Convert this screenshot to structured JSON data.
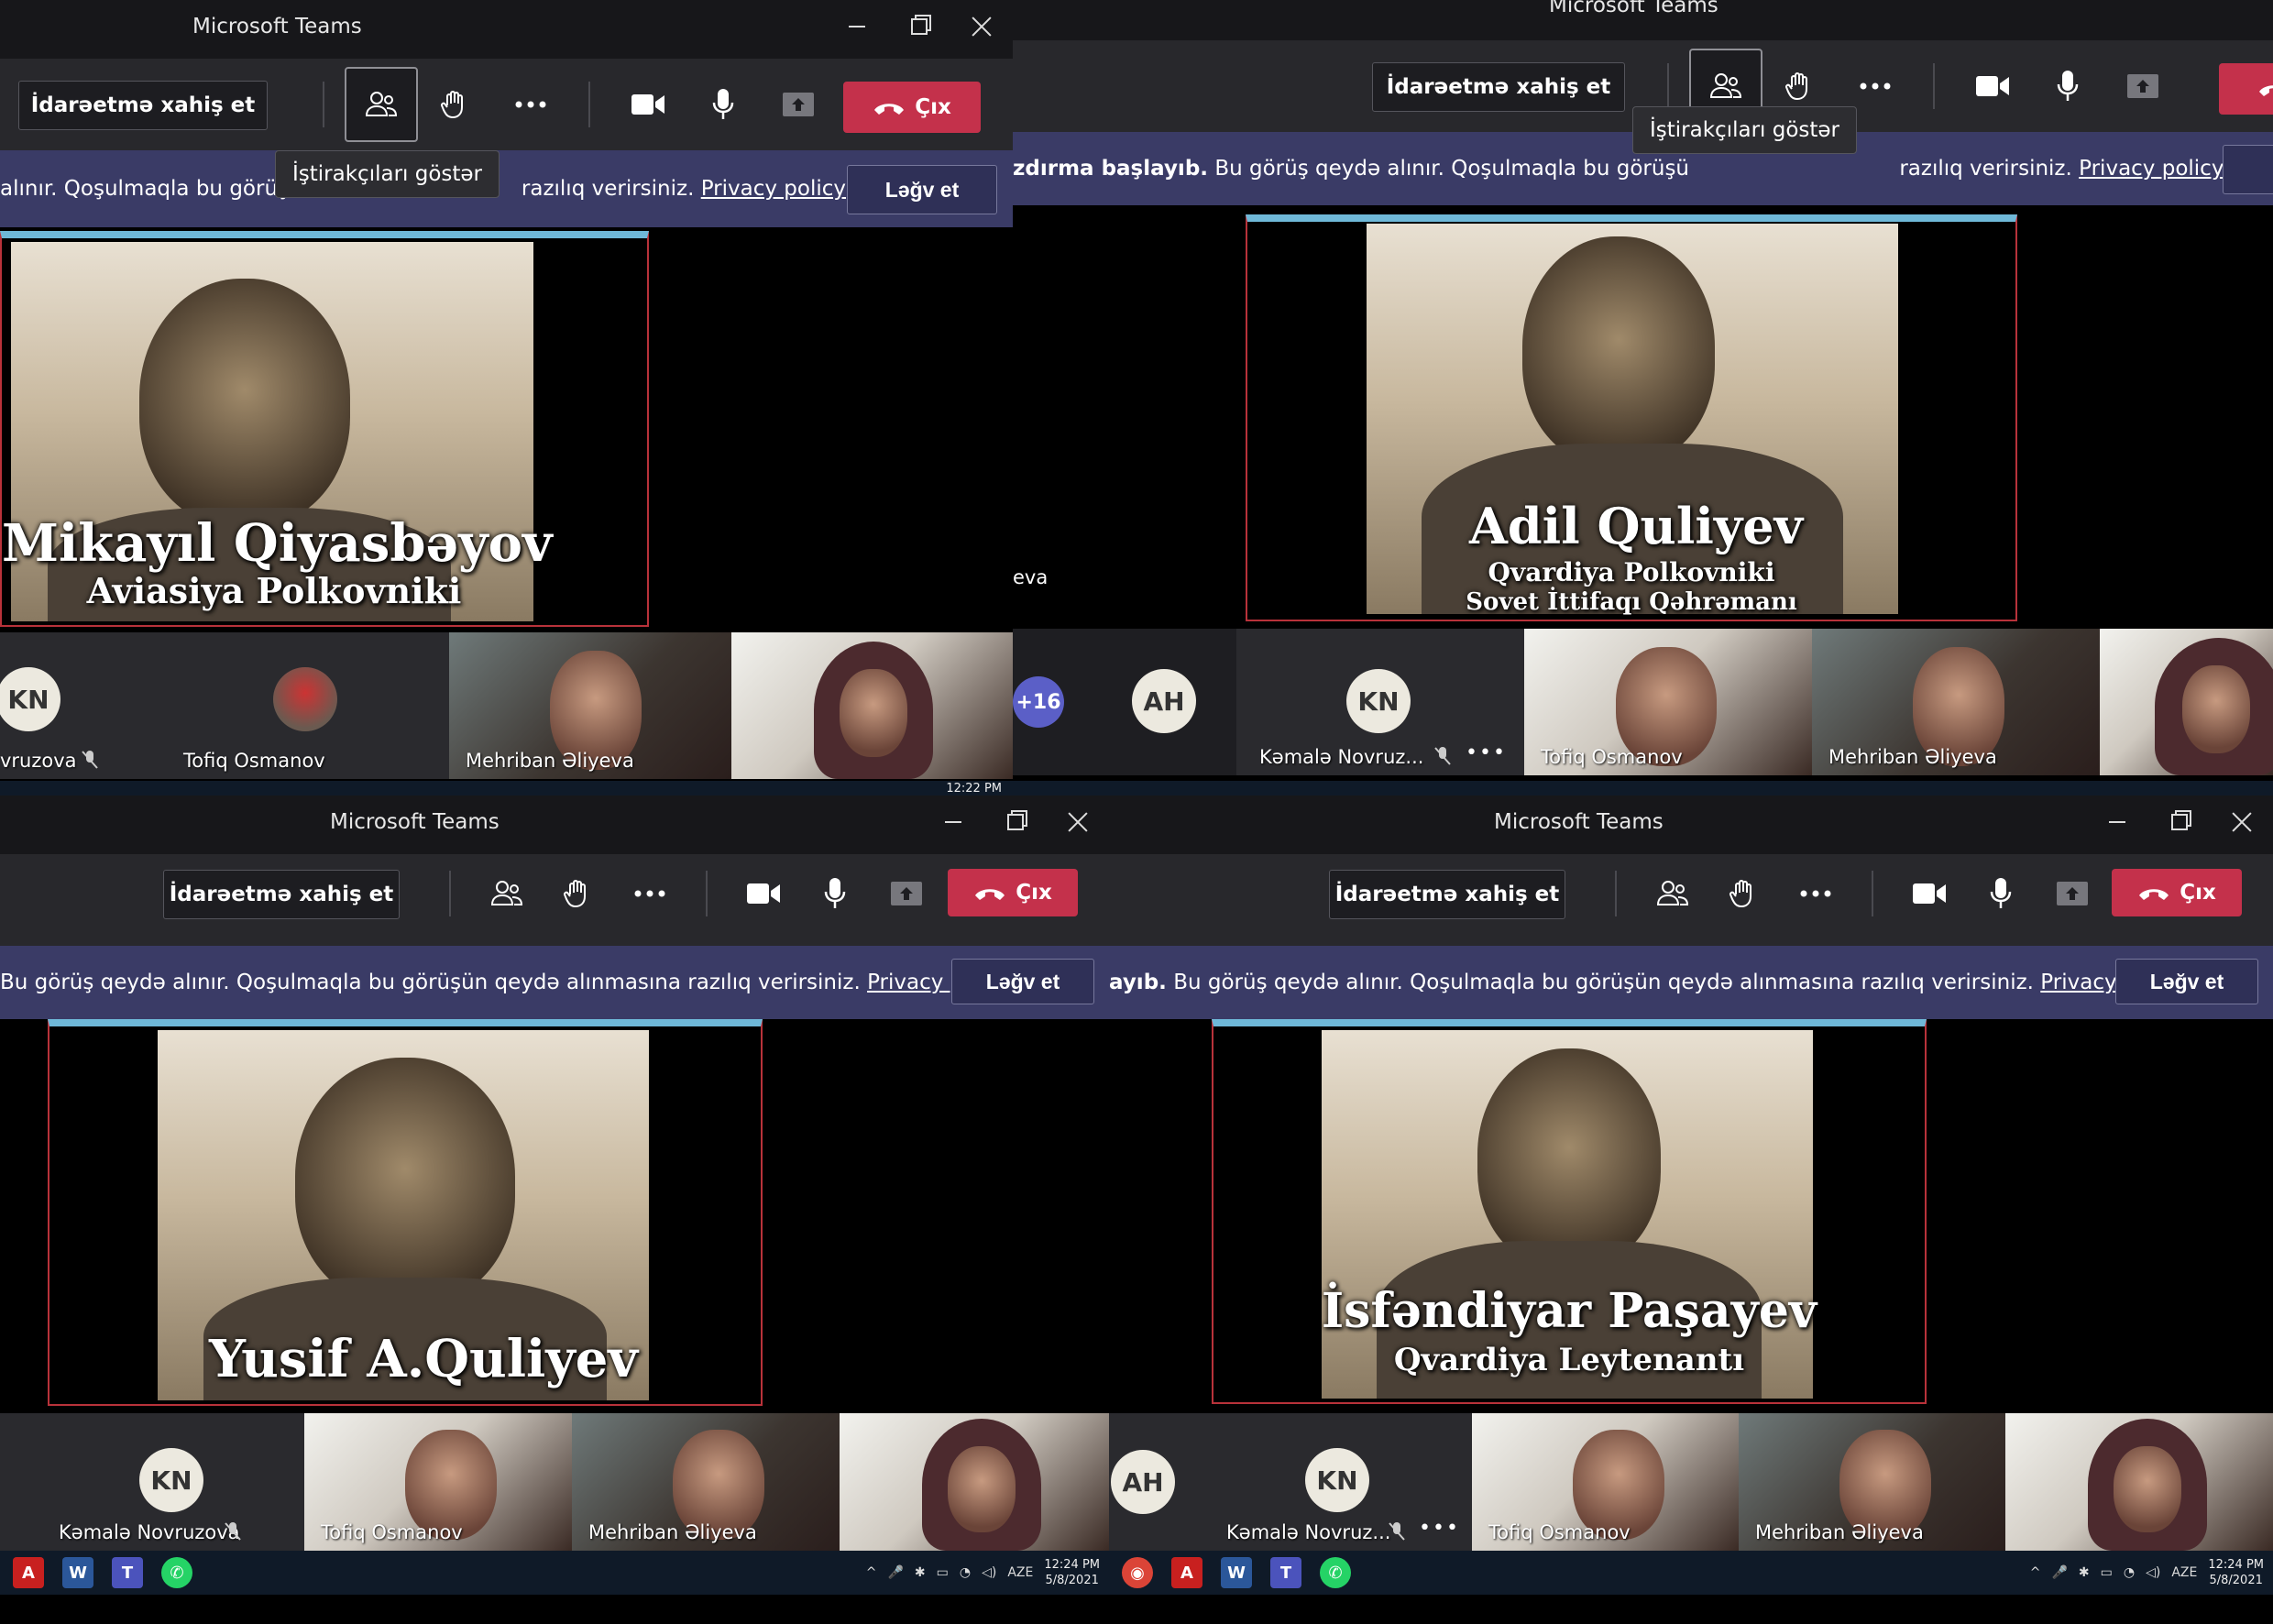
{
  "app": {
    "title": "Microsoft Teams",
    "request_control": "İdarəetmə xahiş et",
    "leave": "Çıx",
    "cancel": "Ləğv et",
    "tooltip_show_participants": "İştirakçıları göstər",
    "privacy": "Privacy policy"
  },
  "banners": {
    "w0": "alınır. Qoşulmaqla bu görüşü",
    "w0_tail": "razılıq verirsiniz.",
    "w1_bold": "zdırma başlayıb.",
    "w1": "Bu görüş qeydə alınır. Qoşulmaqla bu görüşü",
    "w1_tail": "razılıq verirsiniz.",
    "w2": "Bu görüş qeydə alınır. Qoşulmaqla bu görüşün qeydə alınmasına razılıq verirsiniz.",
    "w3_bold": "ayıb.",
    "w3": "Bu görüş qeydə alınır. Qoşulmaqla bu görüşün qeydə alınmasına razılıq verirsiniz."
  },
  "slides": {
    "w0": {
      "name": "Mikayıl Qiyasbəyov",
      "rank": "Aviasiya Polkovniki"
    },
    "w1": {
      "name": "Adil Quliyev",
      "rank": "Qvardiya Polkovniki",
      "extra": "Sovet İttifaqı Qəhrəmanı"
    },
    "w2": {
      "name": "Yusif A.Quliyev"
    },
    "w3": {
      "name": "İsfəndiyar Paşayev",
      "rank": "Qvardiya Leytenantı"
    }
  },
  "participants": {
    "kn_initials": "KN",
    "ah_initials": "AH",
    "kamala_full": "Kəmalə Novruzova",
    "kamala_short": "Kəmalə Novruz...",
    "kamala_cut": "vruzova",
    "tofiq": "Tofiq Osmanov",
    "mehriban": "Mehriban Əliyeva",
    "side_cut": "eva",
    "plus_count": "+16"
  },
  "taskbar": {
    "lang": "AZE",
    "time_w0": "12:22 PM",
    "time": "12:24 PM",
    "date": "5/8/2021"
  },
  "colors": {
    "leave_red": "#c4314b",
    "banner_purple": "#3a3b66",
    "teams_accent": "#5b5fc7"
  }
}
